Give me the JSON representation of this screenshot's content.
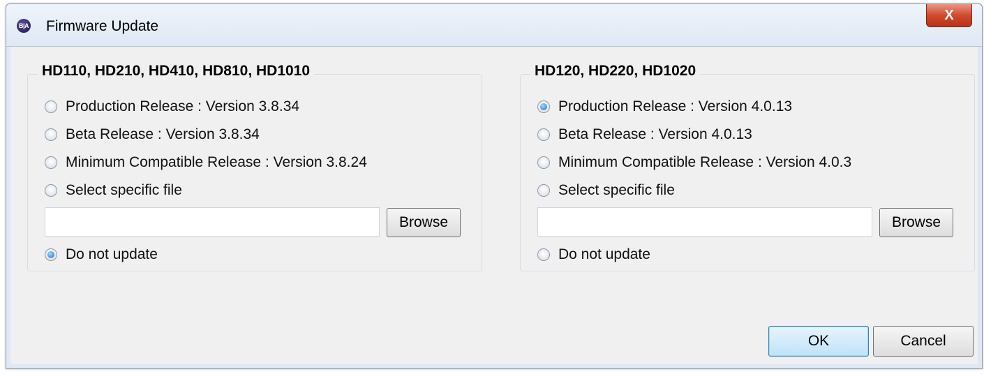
{
  "window": {
    "title": "Firmware Update",
    "app_icon_text": "B|A",
    "close_label": "X"
  },
  "groups": [
    {
      "title": "HD110, HD210, HD410, HD810, HD1010",
      "options": [
        {
          "label": "Production Release : Version 3.8.34",
          "checked": false
        },
        {
          "label": "Beta Release : Version 3.8.34",
          "checked": false
        },
        {
          "label": "Minimum Compatible Release : Version 3.8.24",
          "checked": false
        },
        {
          "label": "Select specific file",
          "checked": false
        }
      ],
      "file_value": "",
      "browse_label": "Browse",
      "no_update": {
        "label": "Do not update",
        "checked": true
      }
    },
    {
      "title": "HD120, HD220, HD1020",
      "options": [
        {
          "label": "Production Release : Version 4.0.13",
          "checked": true
        },
        {
          "label": "Beta Release : Version 4.0.13",
          "checked": false
        },
        {
          "label": "Minimum Compatible Release : Version 4.0.3",
          "checked": false
        },
        {
          "label": "Select specific file",
          "checked": false
        }
      ],
      "file_value": "",
      "browse_label": "Browse",
      "no_update": {
        "label": "Do not update",
        "checked": false
      }
    }
  ],
  "buttons": {
    "ok_label": "OK",
    "cancel_label": "Cancel"
  }
}
